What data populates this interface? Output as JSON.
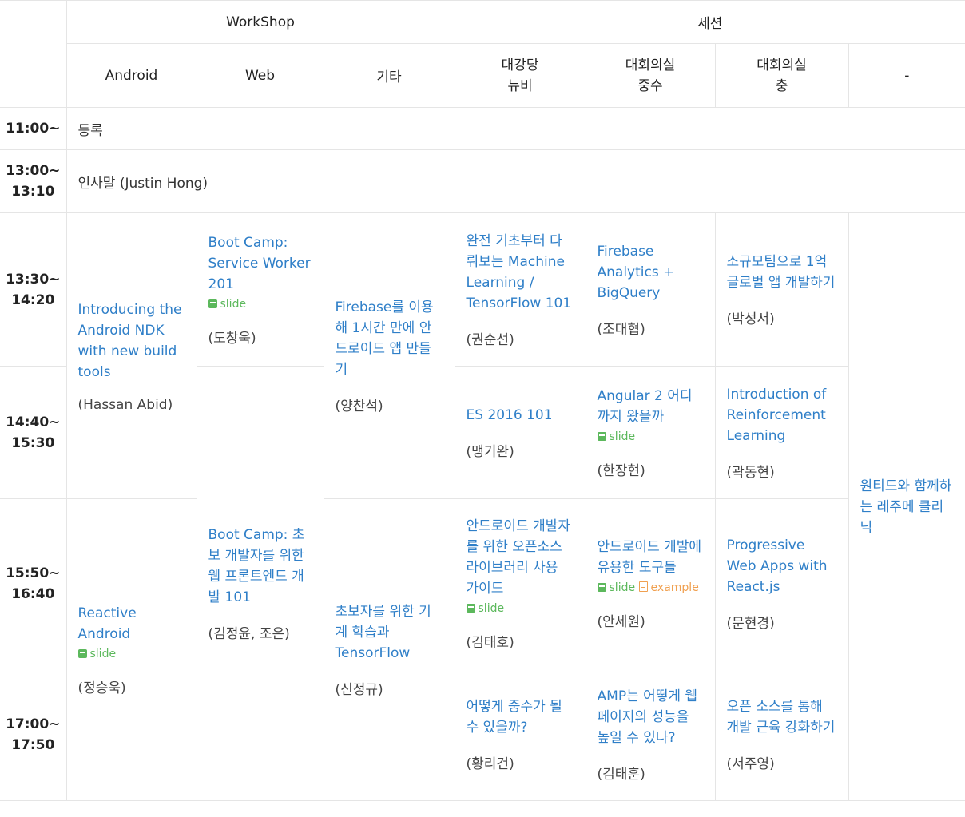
{
  "headers": {
    "workshop": "WorkShop",
    "session": "세션",
    "android": "Android",
    "web": "Web",
    "etc": "기타",
    "hall_line1": "대강당",
    "hall_line2": "뉴비",
    "room1_line1": "대회의실",
    "room1_line2": "중수",
    "room2_line1": "대회의실",
    "room2_line2": "충",
    "dash": "-"
  },
  "times": {
    "t1": "11:00~",
    "t2a": "13:00~",
    "t2b": "13:10",
    "t3a": "13:30~",
    "t3b": "14:20",
    "t4a": "14:40~",
    "t4b": "15:30",
    "t5a": "15:50~",
    "t5b": "16:40",
    "t6a": "17:00~",
    "t6b": "17:50"
  },
  "registration": "등록",
  "greeting": "인사말 (Justin Hong)",
  "link_labels": {
    "slide": "slide",
    "example": "example"
  },
  "icons": {
    "slide": "slide-icon",
    "example": "document-icon"
  },
  "colors": {
    "link": "#2f7fc8",
    "slide": "#5cb85c",
    "example": "#f0a050"
  },
  "sessions": {
    "android_ndk": {
      "title": "Introducing the Android NDK with new build tools",
      "speaker": "(Hassan Abid)"
    },
    "reactive_android": {
      "title": "Reactive Android",
      "speaker": "(정승욱)"
    },
    "bootcamp_sw": {
      "title": "Boot Camp: Service Worker 201",
      "speaker": "(도창욱)"
    },
    "bootcamp_fe": {
      "title": "Boot Camp: 초보 개발자를 위한 웹 프론트엔드 개발 101",
      "speaker": "(김정윤, 조은)"
    },
    "firebase_app": {
      "title": "Firebase를 이용해 1시간 만에 안드로이드 앱 만들기",
      "speaker": "(양찬석)"
    },
    "ml_beginner": {
      "title": "초보자를 위한 기계 학습과 TensorFlow",
      "speaker": "(신정규)"
    },
    "ml_tf101": {
      "title": "완전 기초부터 다뤄보는 Machine Learning / TensorFlow 101",
      "speaker": "(권순선)"
    },
    "es2016": {
      "title": "ES 2016 101",
      "speaker": "(맹기완)"
    },
    "oss_libs": {
      "title": "안드로이드 개발자를 위한 오픈소스 라이브러리 사용 가이드",
      "speaker": "(김태호)"
    },
    "become_mid": {
      "title": "어떻게 중수가 될 수 있을까?",
      "speaker": "(황리건)"
    },
    "firebase_bq": {
      "title": "Firebase Analytics + BigQuery",
      "speaker": "(조대협)"
    },
    "angular2": {
      "title": "Angular 2 어디까지 왔을까",
      "speaker": "(한장현)"
    },
    "android_tools": {
      "title": "안드로이드 개발에 유용한 도구들",
      "speaker": "(안세원)"
    },
    "amp": {
      "title": "AMP는 어떻게 웹 페이지의 성능을 높일 수 있나?",
      "speaker": "(김태훈)"
    },
    "small_group": {
      "title": "소규모팀으로 1억 글로벌 앱 개발하기",
      "speaker": "(박성서)"
    },
    "reinforcement": {
      "title": "Introduction of Reinforcement Learning",
      "speaker": "(곽동현)"
    },
    "pwa_react": {
      "title": "Progressive Web Apps with React.js",
      "speaker": "(문현경)"
    },
    "oss_career": {
      "title": "오픈 소스를 통해 개발 근육 강화하기",
      "speaker": "(서주영)"
    },
    "wantedly": {
      "title": "원티드와 함께하는 레주메 클리닉"
    }
  }
}
